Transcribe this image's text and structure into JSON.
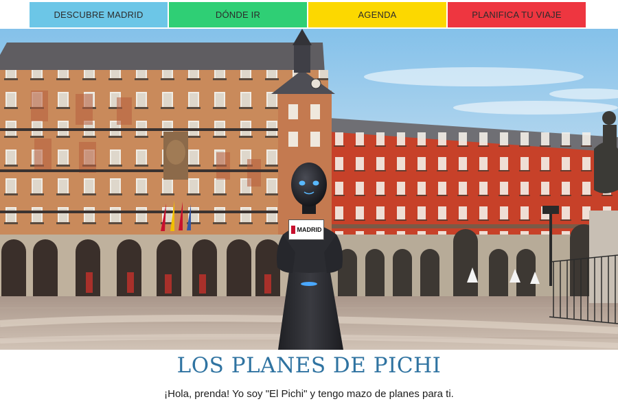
{
  "nav": {
    "items": [
      {
        "label": "DESCUBRE MADRID",
        "color": "#6cc6e7"
      },
      {
        "label": "DÓNDE IR",
        "color": "#2fcf75"
      },
      {
        "label": "AGENDA",
        "color": "#fcd800"
      },
      {
        "label": "PLANIFICA TU VIAJE",
        "color": "#ee3640"
      }
    ]
  },
  "hero": {
    "robot_sign": "MADRID",
    "scene": "plaza-mayor-madrid"
  },
  "page": {
    "title": "LOS PLANES DE PICHI",
    "subtitle": "¡Hola, prenda! Yo soy \"El Pichi\" y tengo mazo de planes para ti."
  },
  "colors": {
    "title": "#2f73a1",
    "facade_red": "#c8402c",
    "sky_top": "#8cc4e8"
  }
}
